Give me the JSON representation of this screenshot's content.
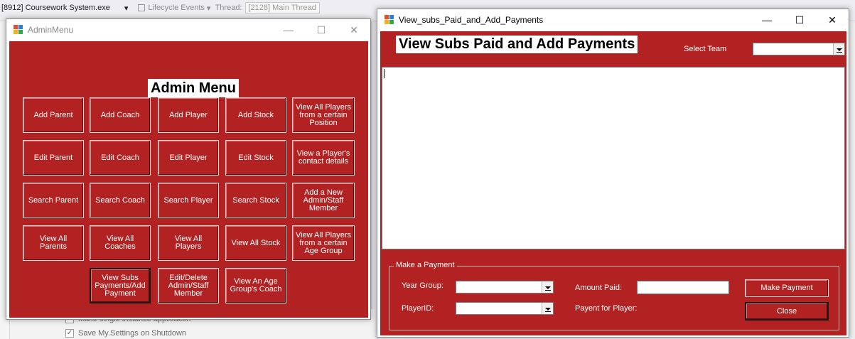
{
  "ide": {
    "process": "[8912] Coursework System.exe",
    "lifecycle": "Lifecycle Events",
    "thread_label": "Thread:",
    "thread_value": "[2128] Main Thread",
    "opt_single_instance": "Make single instance application",
    "opt_save_settings": "Save My.Settings on Shutdown"
  },
  "admin": {
    "window_title": "AdminMenu",
    "heading": "Admin Menu",
    "buttons": {
      "add_parent": "Add Parent",
      "add_coach": "Add Coach",
      "add_player": "Add Player",
      "add_stock": "Add Stock",
      "view_players_position": "View All Players from a certain Position",
      "edit_parent": "Edit Parent",
      "edit_coach": "Edit Coach",
      "edit_player": "Edit Player",
      "edit_stock": "Edit Stock",
      "view_contact": "View a Player's contact details",
      "search_parent": "Search Parent",
      "search_coach": "Search Coach",
      "search_player": "Search Player",
      "search_stock": "Search Stock",
      "add_admin": "Add a New Admin/Staff Member",
      "view_parents": "View All Parents",
      "view_coaches": "View All Coaches",
      "view_players": "View All Players",
      "view_stock": "View All Stock",
      "view_players_age": "View All Players from a certain Age Group",
      "view_subs": "View Subs Payments/Add Payment",
      "edit_delete_admin": "Edit/Delete Admin/Staff Member",
      "view_age_coach": "View An Age Group's Coach"
    }
  },
  "subs": {
    "window_title": "View_subs_Paid_and_Add_Payments",
    "heading": "View Subs Paid and Add Payments",
    "select_team_label": "Select Team",
    "select_team_value": "",
    "payment_group_label": "Make a Payment",
    "year_group_label": "Year Group:",
    "year_group_value": "",
    "player_id_label": "PlayerID:",
    "player_id_value": "",
    "amount_paid_label": "Amount Paid:",
    "amount_paid_value": "",
    "payment_for_label": "Payent for Player:",
    "make_payment_button": "Make Payment",
    "close_button": "Close"
  },
  "colors": {
    "form_background": "#b22222",
    "window_background": "#ffffff"
  }
}
